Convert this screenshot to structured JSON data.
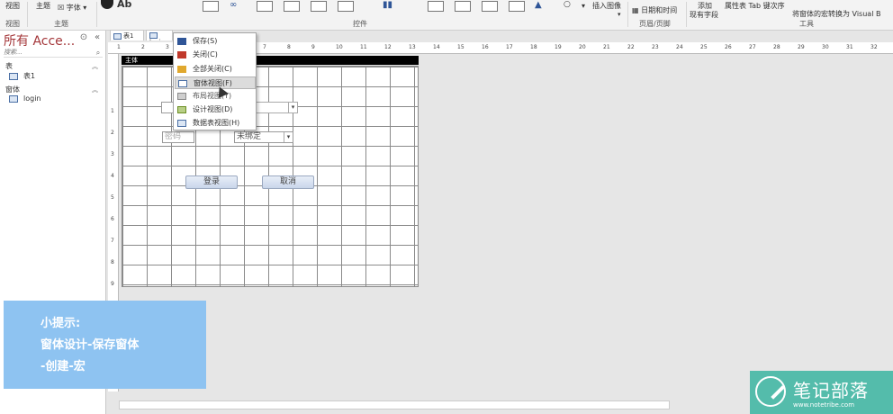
{
  "ribbon": {
    "view_label": "视图",
    "view_group": "视图",
    "theme_label": "主题",
    "font_label": "字体",
    "theme_group": "主题",
    "controls_group": "控件",
    "insert_image_label": "插入图像",
    "header_footer_datetime": "日期和时间",
    "header_footer_group": "页眉/页脚",
    "add_existing_fields_1": "添加",
    "add_existing_fields_2": "现有字段",
    "property_sheet": "属性表 Tab 键次序",
    "convert_vba": "将窗体的宏转换为 Visual B",
    "tools_group": "工具"
  },
  "nav": {
    "title": "所有 Acce...",
    "search_placeholder": "搜索...",
    "categories": [
      {
        "label": "表",
        "items": [
          "表1"
        ]
      },
      {
        "label": "窗体",
        "items": [
          "login"
        ]
      }
    ]
  },
  "tabs": [
    {
      "label": "表1"
    },
    {
      "label": "login"
    }
  ],
  "ruler": {
    "h": [
      "1",
      "2",
      "3",
      "4",
      "5",
      "6",
      "7",
      "8",
      "9",
      "10",
      "11",
      "12",
      "13",
      "14",
      "15",
      "16",
      "17",
      "18",
      "19",
      "20",
      "21",
      "22",
      "23",
      "24",
      "25",
      "26",
      "27",
      "28",
      "29",
      "30",
      "31",
      "32"
    ],
    "v": [
      "1",
      "2",
      "3",
      "4",
      "5",
      "6",
      "7",
      "8",
      "9",
      "10"
    ]
  },
  "form": {
    "section_label": "主体",
    "password_placeholder": "密码",
    "unbound_label": "未绑定",
    "login_button": "登录",
    "cancel_button": "取消"
  },
  "context_menu": {
    "items": [
      {
        "label": "保存(S)",
        "icon": "save-icon",
        "color": "#2f5597"
      },
      {
        "label": "关闭(C)",
        "icon": "close-icon",
        "color": "#c0392b"
      },
      {
        "label": "全部关闭(C)",
        "icon": "folder-icon",
        "color": "#e0a82e"
      },
      {
        "label": "窗体视图(F)",
        "icon": "form-view-icon",
        "color": "#4a6fa5",
        "highlighted": true
      },
      {
        "label": "布局视图(Y)",
        "icon": "layout-view-icon",
        "color": "#8a8a8a"
      },
      {
        "label": "设计视图(D)",
        "icon": "design-view-icon",
        "color": "#6b8e23"
      },
      {
        "label": "数据表视图(H)",
        "icon": "datasheet-view-icon",
        "color": "#4a6fa5"
      }
    ]
  },
  "tip": {
    "title": "小提示:",
    "line1": "窗体设计-保存窗体",
    "line2": "-创建-宏"
  },
  "watermark": {
    "name": "笔记部落",
    "url": "www.notetribe.com",
    "color": "#39b4a0"
  }
}
